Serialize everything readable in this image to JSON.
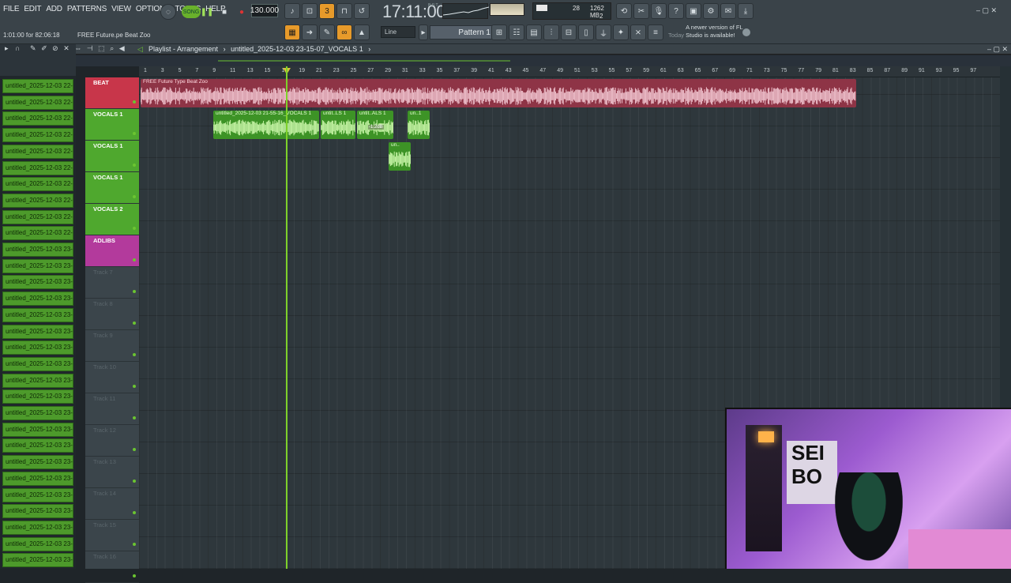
{
  "menu": [
    "FILE",
    "EDIT",
    "ADD",
    "PATTERNS",
    "VIEW",
    "OPTIONS",
    "TOOLS",
    "HELP"
  ],
  "transport": {
    "song_label": "SONG",
    "bpm": "130.000",
    "time": "17:11:00",
    "time_sub": "B:S:T",
    "cpu_value": "28",
    "memory": "1262 MB",
    "poly": "2"
  },
  "hint_left": "1:01:00 for 82:06:18",
  "hint_right": "FREE Future.pe Beat Zoo",
  "snap": "Line",
  "pattern": "Pattern 1",
  "news": {
    "when": "Today",
    "text": "A newer version of FL Studio is available!"
  },
  "playlist": {
    "title_prefix": "Playlist - Arrangement",
    "title_file": "untitled_2025-12-03 23-15-07_VOCALS 1"
  },
  "browser_items": [
    "untitled_2025-12-03 22-...",
    "untitled_2025-12-03 22-...",
    "untitled_2025-12-03 22-...",
    "untitled_2025-12-03 22-...",
    "untitled_2025-12-03 22-...",
    "untitled_2025-12-03 22-...",
    "untitled_2025-12-03 22-...",
    "untitled_2025-12-03 22-...",
    "untitled_2025-12-03 22-...",
    "untitled_2025-12-03 22-...",
    "untitled_2025-12-03 23-...",
    "untitled_2025-12-03 23-...",
    "untitled_2025-12-03 23-...",
    "untitled_2025-12-03 23-...",
    "untitled_2025-12-03 23-...",
    "untitled_2025-12-03 23-...",
    "untitled_2025-12-03 23-...",
    "untitled_2025-12-03 23-...",
    "untitled_2025-12-03 23-...",
    "untitled_2025-12-03 23-...",
    "untitled_2025-12-03 23-...",
    "untitled_2025-12-03 23-...",
    "untitled_2025-12-03 23-...",
    "untitled_2025-12-03 23-...",
    "untitled_2025-12-03 23-...",
    "untitled_2025-12-03 23-...",
    "untitled_2025-12-03 23-...",
    "untitled_2025-12-03 23-...",
    "untitled_2025-12-03 23-...",
    "untitled_2025-12-03 23-..."
  ],
  "ruler": [
    "1",
    "3",
    "5",
    "7",
    "9",
    "11",
    "13",
    "15",
    "17",
    "19",
    "21",
    "23",
    "25",
    "27",
    "29",
    "31",
    "33",
    "35",
    "37",
    "39",
    "41",
    "43",
    "45",
    "47",
    "49",
    "51",
    "53",
    "55",
    "57",
    "59",
    "61",
    "63",
    "65",
    "67",
    "69",
    "71",
    "73",
    "75",
    "77",
    "79",
    "81",
    "83",
    "85",
    "87",
    "89",
    "91",
    "93",
    "95",
    "97"
  ],
  "tracks": [
    {
      "name": "BEAT",
      "color": "#c8364a"
    },
    {
      "name": "VOCALS 1",
      "color": "#4fa82e"
    },
    {
      "name": "VOCALS 1",
      "color": "#4fa82e"
    },
    {
      "name": "VOCALS 1",
      "color": "#4fa82e"
    },
    {
      "name": "VOCALS 2",
      "color": "#4fa82e"
    },
    {
      "name": "ADLIBS",
      "color": "#b33a9c"
    },
    {
      "name": "Track 7",
      "color": ""
    },
    {
      "name": "Track 8",
      "color": ""
    },
    {
      "name": "Track 9",
      "color": ""
    },
    {
      "name": "Track 10",
      "color": ""
    },
    {
      "name": "Track 11",
      "color": ""
    },
    {
      "name": "Track 12",
      "color": ""
    },
    {
      "name": "Track 13",
      "color": ""
    },
    {
      "name": "Track 14",
      "color": ""
    },
    {
      "name": "Track 15",
      "color": ""
    },
    {
      "name": "Track 16",
      "color": ""
    }
  ],
  "clips": {
    "beat": "FREE Future Type Beat Zoo",
    "vocal_main": "untitled_2025-12-03 21-55-16_VOCALS 1",
    "vocal_b": "untit..LS 1",
    "vocal_c": "untit..ALS 1",
    "vocal_d": "un..1",
    "vocal_e": "un..",
    "gain": "-1.2dB"
  },
  "colors": {
    "accent_green": "#6bc431",
    "beat_red": "#c8364a",
    "orange": "#e79a2a"
  }
}
